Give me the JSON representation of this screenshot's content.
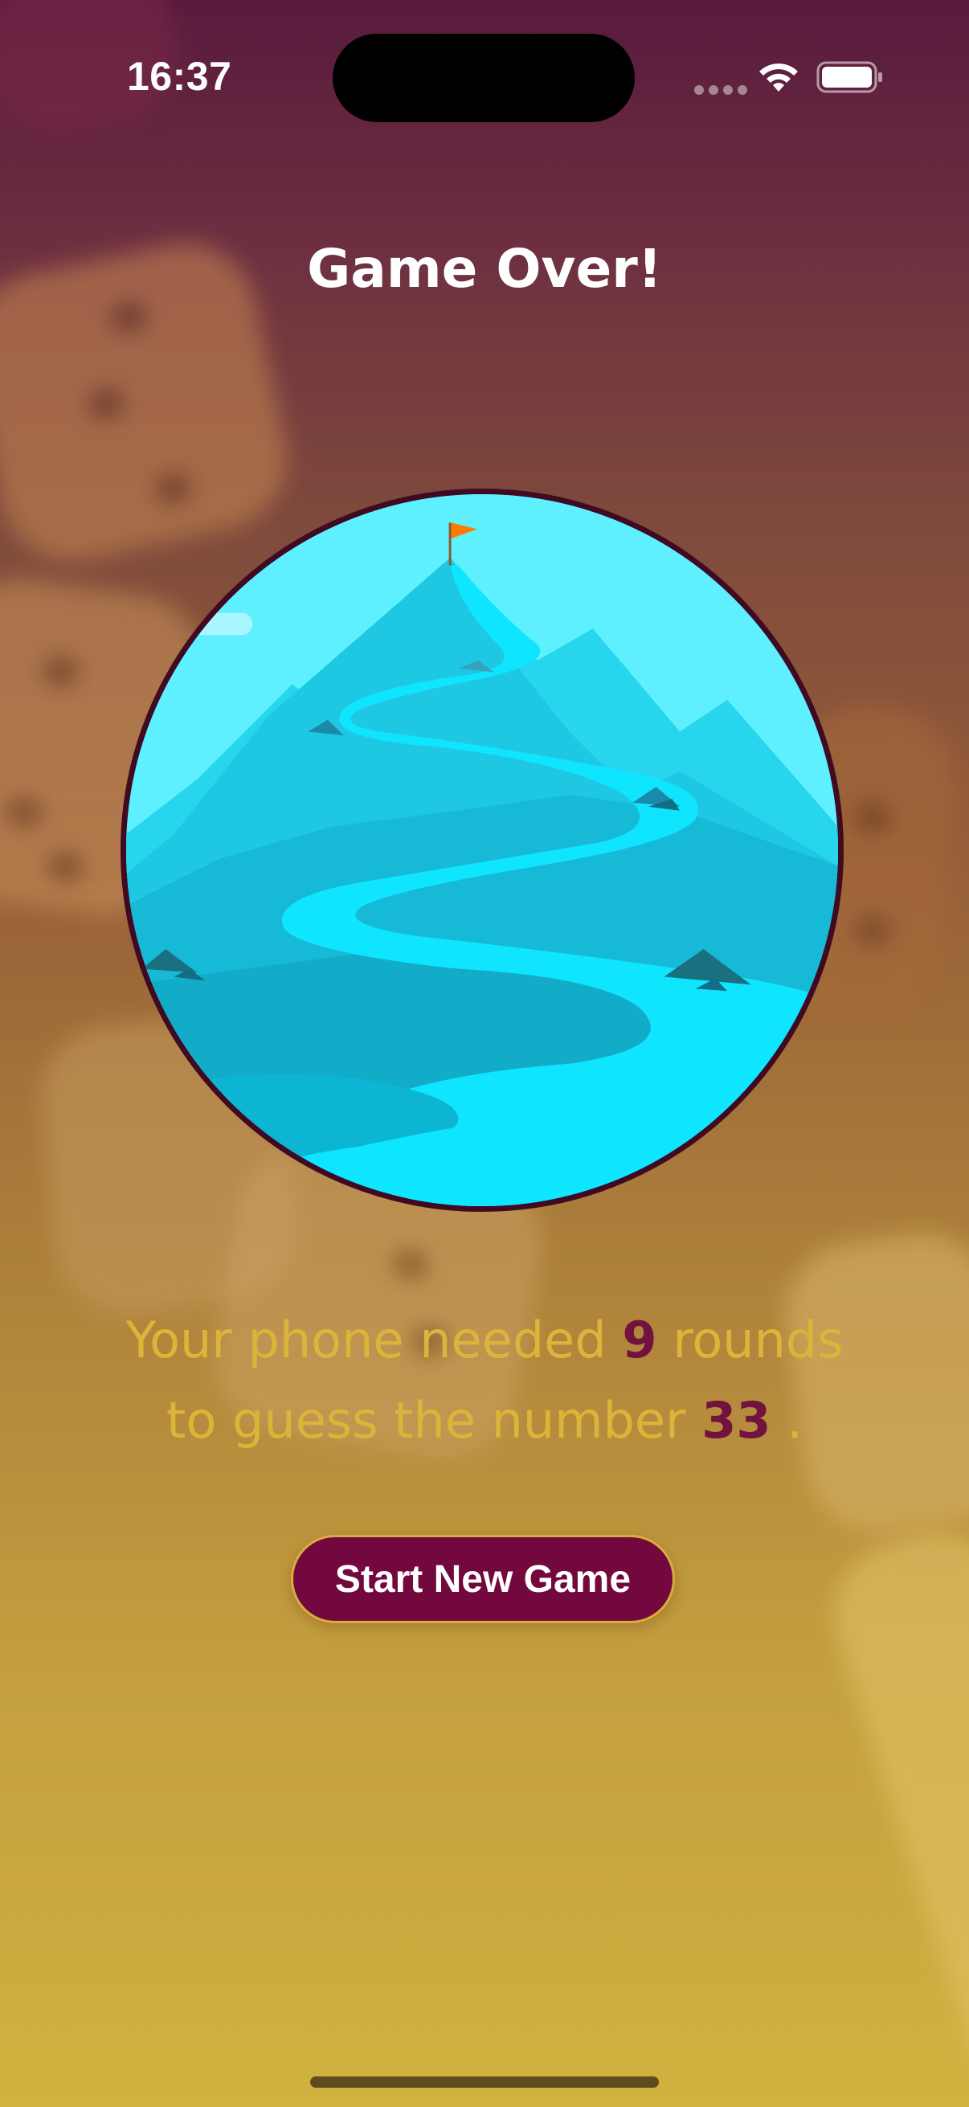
{
  "status_bar": {
    "time": "16:37",
    "icons": [
      "cellular-signal-icon",
      "wifi-icon",
      "battery-icon"
    ]
  },
  "screen": {
    "title": "Game Over!"
  },
  "illustration": {
    "description_icon": "mountain-summit-flag-icon"
  },
  "summary": {
    "line1_prefix": "Your phone needed ",
    "rounds": "9",
    "line1_suffix": " rounds",
    "line2_prefix": "to guess the number ",
    "number": "33",
    "line2_suffix": " ."
  },
  "actions": {
    "start_new_game_label": "Start New Game"
  },
  "colors": {
    "background_top": "#591a3d",
    "background_bottom": "#d0b23f",
    "accent": "#72083e",
    "summary_text": "#dcb43a",
    "button_border": "#d9ad3d"
  }
}
